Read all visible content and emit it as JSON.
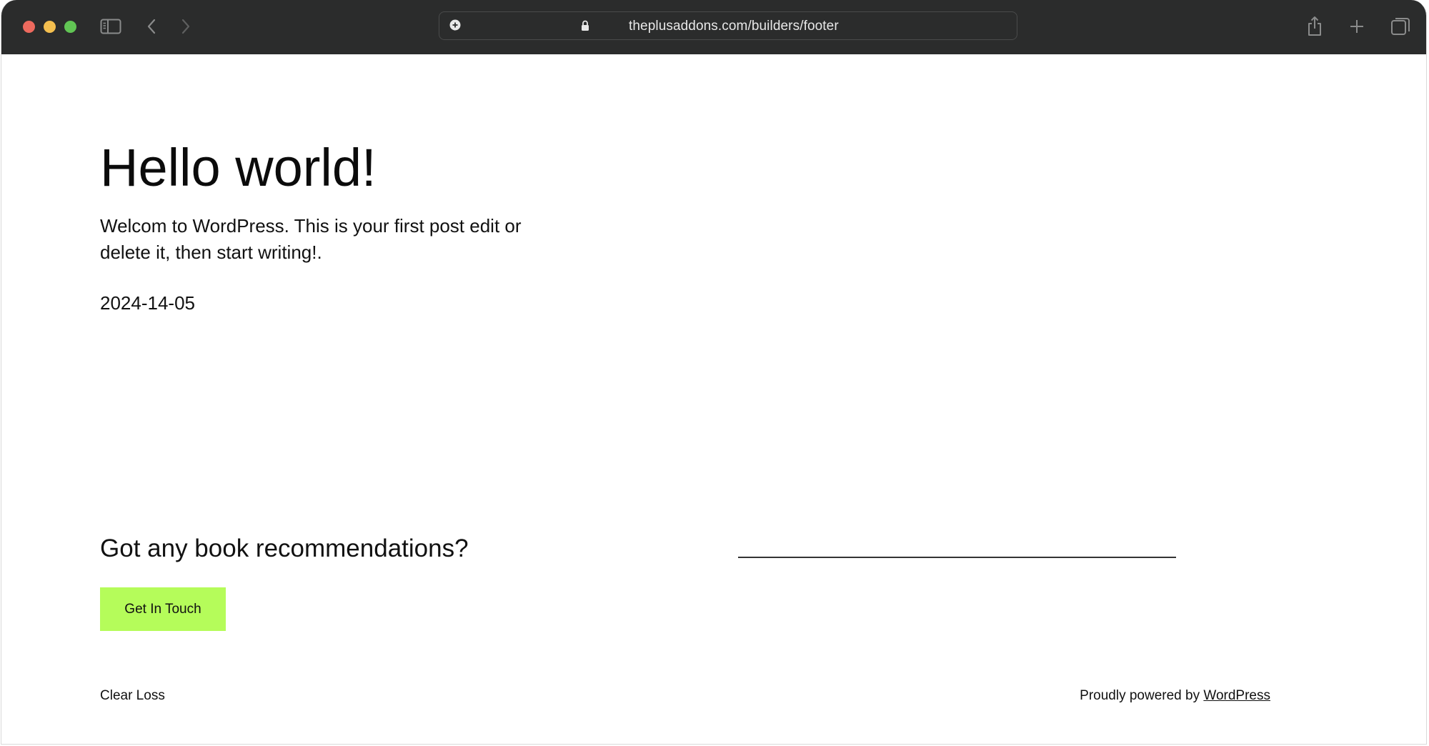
{
  "browser": {
    "url": "theplusaddons.com/builders/footer",
    "icons": {
      "sidebar": "sidebar-icon",
      "back": "chevron-left-icon",
      "forward": "chevron-right-icon",
      "share": "share-icon",
      "new_tab": "plus-icon",
      "tabs": "tab-overview-icon",
      "site_settings": "page-settings-icon",
      "lock": "lock-icon"
    }
  },
  "post": {
    "title": "Hello world!",
    "excerpt": "Welcom to WordPress. This is your first post edit or delete it, then start writing!.",
    "date": "2024-14-05"
  },
  "cta": {
    "heading": "Got any book recommendations?",
    "button_label": "Get In Touch"
  },
  "footer": {
    "site_name": "Clear Loss",
    "credit_prefix": "Proudly powered by ",
    "credit_link": "WordPress"
  },
  "colors": {
    "titlebar": "#2b2c2c",
    "button_bg": "#b5fc5a",
    "text": "#111111"
  }
}
